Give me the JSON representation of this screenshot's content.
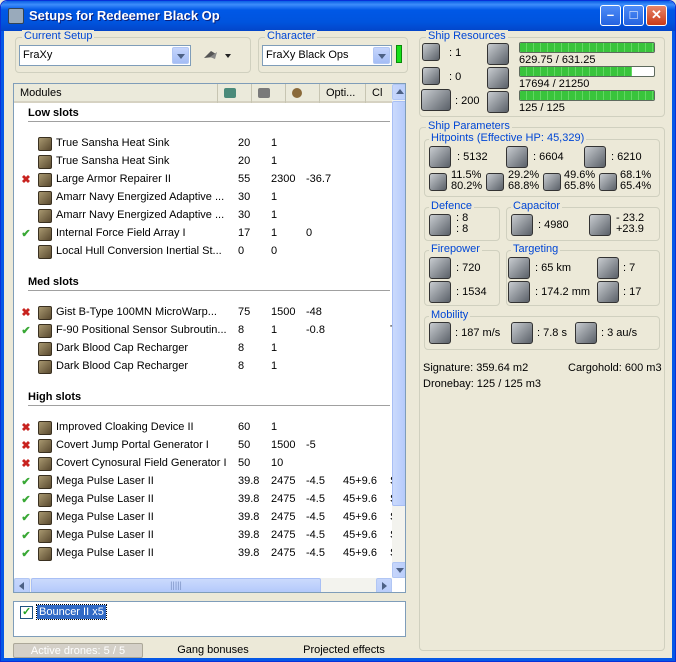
{
  "window": {
    "title": "Setups for Redeemer Black Op"
  },
  "current_setup": {
    "legend": "Current Setup",
    "value": "FraXy"
  },
  "character": {
    "legend": "Character",
    "value": "FraXy Black Ops"
  },
  "modules": {
    "headers": [
      "Modules",
      "",
      "",
      "",
      "Opti...",
      "Cl"
    ],
    "sections": {
      "low": "Low slots",
      "med": "Med slots",
      "high": "High slots"
    },
    "low_rows": [
      {
        "status": "",
        "name": "True Sansha Heat Sink",
        "a": "20",
        "b": "1",
        "c": "",
        "d": "",
        "e": ""
      },
      {
        "status": "",
        "name": "True Sansha Heat Sink",
        "a": "20",
        "b": "1",
        "c": "",
        "d": "",
        "e": ""
      },
      {
        "status": "x",
        "name": "Large Armor Repairer II",
        "a": "55",
        "b": "2300",
        "c": "-36.7",
        "d": "",
        "e": ""
      },
      {
        "status": "",
        "name": "Amarr Navy Energized Adaptive ...",
        "a": "30",
        "b": "1",
        "c": "",
        "d": "",
        "e": ""
      },
      {
        "status": "",
        "name": "Amarr Navy Energized Adaptive ...",
        "a": "30",
        "b": "1",
        "c": "",
        "d": "",
        "e": ""
      },
      {
        "status": "ok",
        "name": "Internal Force Field Array I",
        "a": "17",
        "b": "1",
        "c": "0",
        "d": "",
        "e": ""
      },
      {
        "status": "",
        "name": "Local Hull Conversion Inertial St...",
        "a": "0",
        "b": "0",
        "c": "",
        "d": "",
        "e": ""
      }
    ],
    "med_rows": [
      {
        "status": "x",
        "name": "Gist B-Type 100MN MicroWarp...",
        "a": "75",
        "b": "1500",
        "c": "-48",
        "d": "",
        "e": ""
      },
      {
        "status": "ok",
        "name": "F-90 Positional Sensor Subroutin...",
        "a": "8",
        "b": "1",
        "c": "-0.8",
        "d": "",
        "e": "Ta"
      },
      {
        "status": "",
        "name": "Dark Blood Cap Recharger",
        "a": "8",
        "b": "1",
        "c": "",
        "d": "",
        "e": ""
      },
      {
        "status": "",
        "name": "Dark Blood Cap Recharger",
        "a": "8",
        "b": "1",
        "c": "",
        "d": "",
        "e": ""
      }
    ],
    "high_rows": [
      {
        "status": "x",
        "name": "Improved Cloaking Device II",
        "a": "60",
        "b": "1",
        "c": "",
        "d": "",
        "e": ""
      },
      {
        "status": "x",
        "name": "Covert Jump Portal Generator I",
        "a": "50",
        "b": "1500",
        "c": "-5",
        "d": "",
        "e": ""
      },
      {
        "status": "x",
        "name": "Covert Cynosural Field Generator I",
        "a": "50",
        "b": "10",
        "c": "",
        "d": "",
        "e": ""
      },
      {
        "status": "ok",
        "name": "Mega Pulse Laser II",
        "a": "39.8",
        "b": "2475",
        "c": "-4.5",
        "d": "45+9.6",
        "e": "Sc"
      },
      {
        "status": "ok",
        "name": "Mega Pulse Laser II",
        "a": "39.8",
        "b": "2475",
        "c": "-4.5",
        "d": "45+9.6",
        "e": "Sc"
      },
      {
        "status": "ok",
        "name": "Mega Pulse Laser II",
        "a": "39.8",
        "b": "2475",
        "c": "-4.5",
        "d": "45+9.6",
        "e": "Sc"
      },
      {
        "status": "ok",
        "name": "Mega Pulse Laser II",
        "a": "39.8",
        "b": "2475",
        "c": "-4.5",
        "d": "45+9.6",
        "e": "Sc"
      },
      {
        "status": "ok",
        "name": "Mega Pulse Laser II",
        "a": "39.8",
        "b": "2475",
        "c": "-4.5",
        "d": "45+9.6",
        "e": "Sc"
      }
    ]
  },
  "drones": {
    "label": "Bouncer II x5",
    "checked": true
  },
  "bottom_tabs": {
    "active_drones": "Active drones: 5 / 5",
    "gang": "Gang bonuses",
    "projected": "Projected effects"
  },
  "ship_resources": {
    "legend": "Ship Resources",
    "turrets": ": 1",
    "launchers": ": 0",
    "calibration": ": 200",
    "cpu": {
      "text": "629.75 / 631.25",
      "fraction": 0.998
    },
    "powergrid": {
      "text": "17694 / 21250",
      "fraction": 0.833
    },
    "drone_bandwidth": {
      "text": "125 / 125",
      "fraction": 1.0
    }
  },
  "ship_parameters": {
    "legend": "Ship Parameters",
    "hitpoints": {
      "legend": "Hitpoints (Effective HP: 45,329)",
      "shield": ": 5132",
      "armor": ": 6604",
      "structure": ": 6210",
      "resists": [
        [
          "11.5%",
          "80.2%"
        ],
        [
          "29.2%",
          "68.8%"
        ],
        [
          "49.6%",
          "65.8%"
        ],
        [
          "68.1%",
          "65.4%"
        ]
      ]
    },
    "defence": {
      "legend": "Defence",
      "v1": ": 8",
      "v2": ": 8"
    },
    "capacitor": {
      "legend": "Capacitor",
      "value": ": 4980",
      "delta_top": "- 23.2",
      "delta_bottom": "+23.9"
    },
    "firepower": {
      "legend": "Firepower",
      "dps": ": 720",
      "volley": ": 1534"
    },
    "targeting": {
      "legend": "Targeting",
      "range": ": 65 km",
      "scan": ": 174.2 mm",
      "max_targets": ": 7",
      "sensor": ": 17"
    },
    "mobility": {
      "legend": "Mobility",
      "speed": ": 187 m/s",
      "align": ": 7.8 s",
      "warp": ": 3 au/s"
    },
    "signature": "Signature: 359.64 m2",
    "cargohold": "Cargohold: 600 m3",
    "dronebay": "Dronebay: 125 / 125 m3"
  },
  "colors": {
    "legend_blue": "#0046d5",
    "error_red": "#c8231f",
    "ok_green": "#39a835",
    "bar_green": "#39c43c"
  }
}
